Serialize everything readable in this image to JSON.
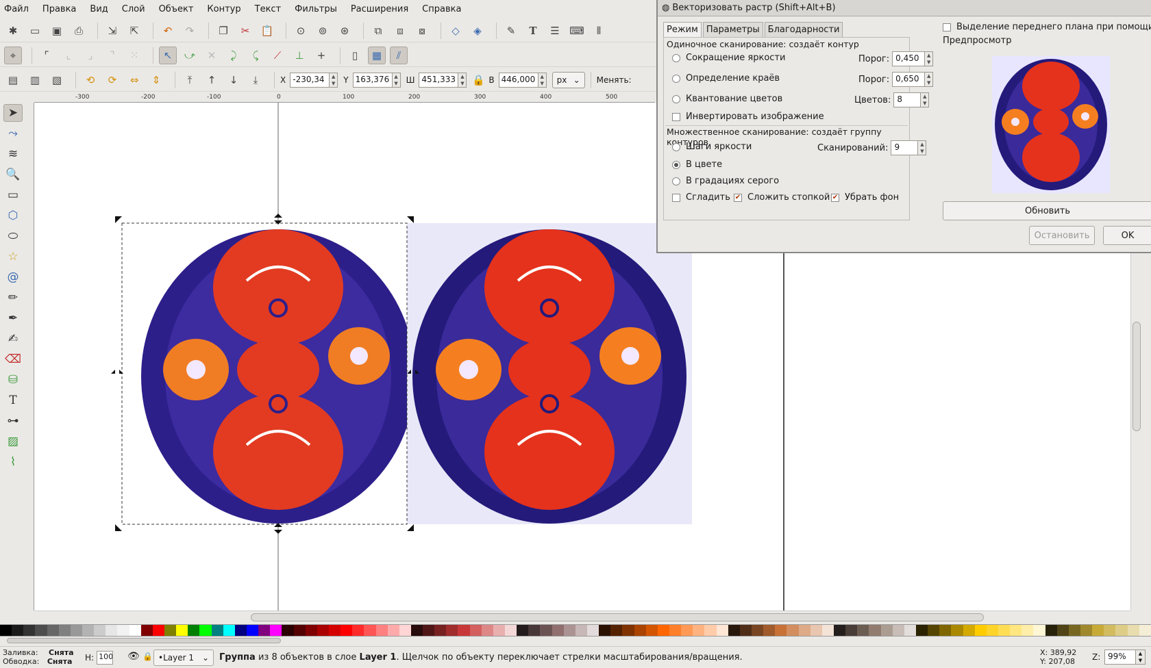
{
  "menu": [
    "Файл",
    "Правка",
    "Вид",
    "Слой",
    "Объект",
    "Контур",
    "Текст",
    "Фильтры",
    "Расширения",
    "Справка"
  ],
  "toolbar3": {
    "x_label": "X",
    "x_value": "-230,34",
    "y_label": "Y",
    "y_value": "163,376",
    "w_label": "Ш",
    "w_value": "451,333",
    "h_label": "В",
    "h_value": "446,000",
    "unit": "px",
    "change_label": "Менять:"
  },
  "ruler": [
    "-300",
    "-200",
    "-100",
    "0",
    "100",
    "200",
    "300",
    "400",
    "500"
  ],
  "dialog": {
    "title": "Векторизовать растр (Shift+Alt+B)",
    "tabs": [
      "Режим",
      "Параметры",
      "Благодарности"
    ],
    "single_group": "Одиночное сканирование: создаёт контур",
    "brightness_label": "Сокращение яркости",
    "threshold_label": "Порог:",
    "brightness_value": "0,450",
    "edges_label": "Определение краёв",
    "edges_value": "0,650",
    "quant_label": "Квантование цветов",
    "colors_label": "Цветов:",
    "colors_value": "8",
    "invert_label": "Инвертировать изображение",
    "multi_group": "Множественное сканирование: создаёт группу контуров",
    "steps_label": "Шаги яркости",
    "scans_label": "Сканирований:",
    "scans_value": "9",
    "color_label": "В цвете",
    "gray_label": "В градациях серого",
    "smooth_label": "Сгладить",
    "stack_label": "Сложить стопкой",
    "remove_bg_label": "Убрать фон",
    "foreground_label": "Выделение переднего плана при помощи",
    "preview_label": "Предпросмотр",
    "update_button": "Обновить",
    "stop_button": "Остановить",
    "ok_button": "OK"
  },
  "status": {
    "fill_label": "Заливка:",
    "fill_value": "Снята",
    "stroke_label": "Обводка:",
    "stroke_value": "Снята",
    "h_label": "Н:",
    "h_value": "100",
    "layer": "•Layer 1",
    "message_bold": "Группа",
    "message_rest": "из 8 объектов в слое",
    "message_layer": "Layer 1",
    "message_tail": ". Щелчок по объекту переключает стрелки масштабирования/вращения.",
    "x_coord": "X: 389,92",
    "y_coord": "Y: 207,08",
    "zoom_label": "Z:",
    "zoom_value": "99%"
  },
  "colors": {
    "palette": [
      "#000000",
      "#1a1a1a",
      "#333333",
      "#4d4d4d",
      "#666666",
      "#808080",
      "#999999",
      "#b3b3b3",
      "#cccccc",
      "#e6e6e6",
      "#f2f2f2",
      "#ffffff",
      "#800000",
      "#ff0000",
      "#808000",
      "#ffff00",
      "#008000",
      "#00ff00",
      "#008080",
      "#00ffff",
      "#000080",
      "#0000ff",
      "#800080",
      "#ff00ff",
      "#2b0000",
      "#550000",
      "#800000",
      "#aa0000",
      "#d40000",
      "#ff0000",
      "#ff2a2a",
      "#ff5555",
      "#ff8080",
      "#ffaaaa",
      "#ffd5d5",
      "#280b0b",
      "#501616",
      "#782121",
      "#a02c2c",
      "#c83737",
      "#d35f5f",
      "#de8787",
      "#e9afaf",
      "#f4d7d7",
      "#241c1c",
      "#483737",
      "#6c5353",
      "#916f6f",
      "#ac9393",
      "#c8b7b7",
      "#e3dbdb",
      "#2b1100",
      "#552200",
      "#803300",
      "#aa4400",
      "#d45500",
      "#ff6600",
      "#ff7f2a",
      "#ff9955",
      "#ffb380",
      "#ffccaa",
      "#ffe6d5",
      "#28170b",
      "#502d16",
      "#784421",
      "#a05a2c",
      "#c87137",
      "#d38d5f",
      "#deaa87",
      "#e9c6af",
      "#f4e3d7",
      "#241f1c",
      "#483e37",
      "#6c5d53",
      "#917c6f",
      "#ac9d93",
      "#c8beb7",
      "#e3dedb",
      "#2b2200",
      "#554400",
      "#806600",
      "#aa8800",
      "#d4aa00",
      "#ffcc00",
      "#ffd42a",
      "#ffdd55",
      "#ffe680",
      "#ffeeaa",
      "#fff6d5",
      "#28220b",
      "#504416",
      "#786721",
      "#a0892c",
      "#c8ab37",
      "#d3bc5f",
      "#decd87",
      "#e9ddaf",
      "#f4eed7"
    ]
  }
}
